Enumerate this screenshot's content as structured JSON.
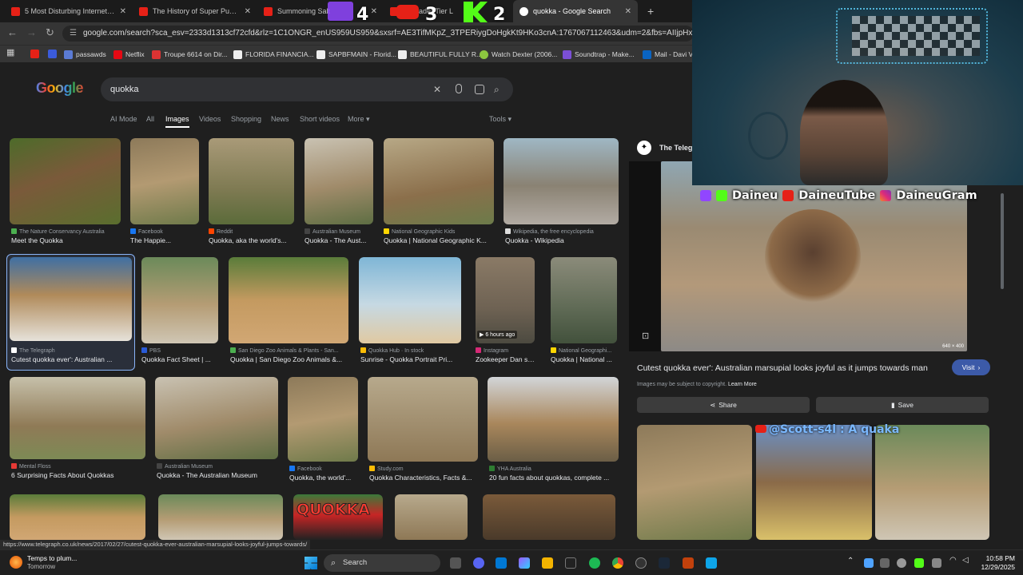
{
  "tabs": [
    {
      "label": "5 Most Disturbing Internet Rab"
    },
    {
      "label": "The History of Super Punch-Ou"
    },
    {
      "label": "Summoning Salt"
    },
    {
      "label": "Crusader Tier L"
    },
    {
      "label": "quokka - Google Search"
    }
  ],
  "toolbar": {
    "url": "google.com/search?sca_esv=2333d1313cf72cfd&rlz=1C1ONGR_enUS959US959&sxsrf=AE3TifMKpZ_3TPERiygDoHgkKt9HKo3cnA:1767067112463&udm=2&fbs=AIIjpHxU7SXXniUZfeShr"
  },
  "bookmarks": [
    {
      "label": "passawds"
    },
    {
      "label": "Netflix"
    },
    {
      "label": "Troupe 6614 on Dir..."
    },
    {
      "label": "FLORIDA FINANCIA..."
    },
    {
      "label": "SAPBFMAIN - Florid..."
    },
    {
      "label": "BEAUTIFUL FULLY R..."
    },
    {
      "label": "Watch Dexter (2006..."
    },
    {
      "label": "Soundtrap - Make..."
    },
    {
      "label": "Mail - Davi V"
    }
  ],
  "search": {
    "query": "quokka",
    "logo": "Google"
  },
  "filters": {
    "items": [
      "AI Mode",
      "All",
      "Images",
      "Videos",
      "Shopping",
      "News",
      "Short videos",
      "More"
    ],
    "active": "Images",
    "tools": "Tools"
  },
  "results": [
    {
      "source": "The Nature Conservancy Australia",
      "title": "Meet the Quokka"
    },
    {
      "source": "Facebook",
      "title": "The Happie..."
    },
    {
      "source": "Reddit",
      "title": "Quokka, aka the world's..."
    },
    {
      "source": "Australian Museum",
      "title": "Quokka - The Aust..."
    },
    {
      "source": "National Geographic Kids",
      "title": "Quokka | National Geographic K..."
    },
    {
      "source": "Wikipedia, the free encyclopedia",
      "title": "Quokka - Wikipedia"
    },
    {
      "source": "The Telegraph",
      "title": "Cutest quokka ever': Australian ..."
    },
    {
      "source": "PBS",
      "title": "Quokka Fact Sheet | ..."
    },
    {
      "source": "San Diego Zoo Animals & Plants - San...",
      "title": "Quokka | San Diego Zoo Animals &..."
    },
    {
      "source": "Quokka Hub · In stock",
      "title": "Sunrise - Quokka Portrait Pri..."
    },
    {
      "source": "Instagram",
      "title": "Zookeeper Dan sp...",
      "badge": "6 hours ago"
    },
    {
      "source": "National Geographi...",
      "title": "Quokka | National ..."
    },
    {
      "source": "Mental Floss",
      "title": "6 Surprising Facts About Quokkas"
    },
    {
      "source": "Australian Museum",
      "title": "Quokka - The Australian Museum"
    },
    {
      "source": "Facebook",
      "title": "Quokka, the world'..."
    },
    {
      "source": "Study.com",
      "title": "Quokka Characteristics, Facts &..."
    },
    {
      "source": "YHA Australia",
      "title": "20 fun facts about quokkas, complete ..."
    }
  ],
  "bottom_row_text": "QUOKKA",
  "panel": {
    "source": "The Telegr",
    "title": "Cutest quokka ever': Australian marsupial looks joyful as it jumps towards man",
    "visit": "Visit",
    "copyright": "Images may be subject to copyright.",
    "learn_more": "Learn More",
    "share": "Share",
    "save": "Save",
    "dims": "640 × 400"
  },
  "overlay": {
    "streamer": [
      "Daineu",
      "DaineuTube",
      "DaineuGram"
    ],
    "comment": "@Scott-s4l : A quaka",
    "ranks": [
      "4",
      "3",
      "2"
    ]
  },
  "statusbar": {
    "url": "https://www.telegraph.co.uk/news/2017/02/27/cutest-quokka-ever-australian-marsupial-looks-joyful-jumps-towards/"
  },
  "taskbar": {
    "weather_title": "Temps to plum...",
    "weather_sub": "Tomorrow",
    "search": "Search",
    "time": "10:58 PM",
    "date": "12/29/2025"
  },
  "colors": {
    "accent": "#8ab4f8",
    "visit_bg": "#3c5aa8",
    "youtube_red": "#e62117"
  }
}
